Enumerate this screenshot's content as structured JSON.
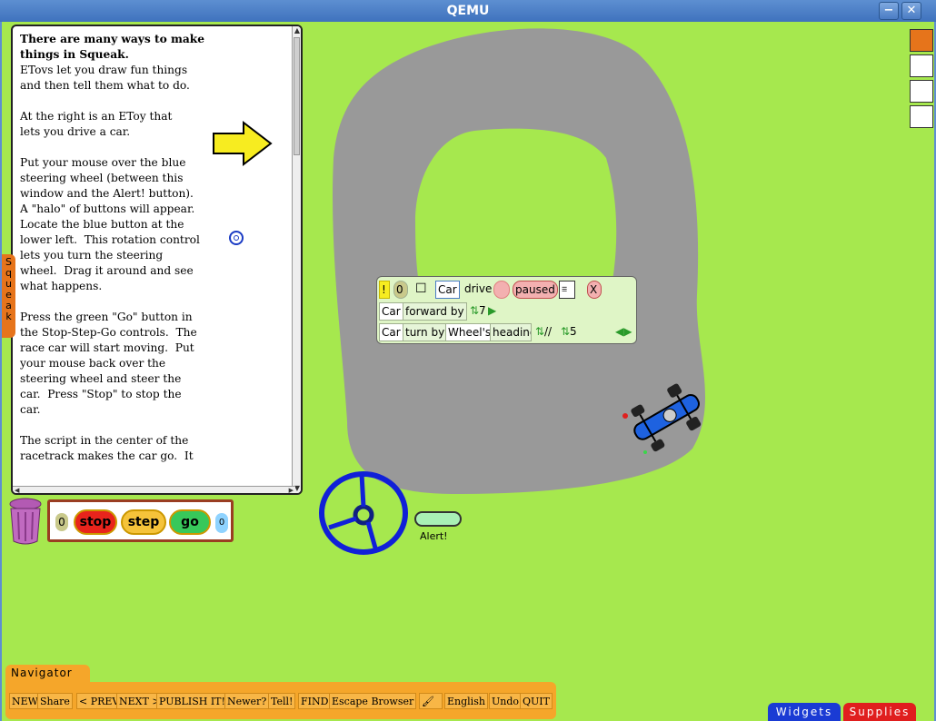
{
  "window": {
    "title": "QEMU",
    "minimize_icon": "−",
    "close_icon": "✕"
  },
  "text_window": {
    "heading": "There are many ways to make\nthings in Squeak.",
    "body": "\nETovs let you draw fun things\nand then tell them what to do.\n\nAt the right is an EToy that\nlets you drive a car.\n\nPut your mouse over the blue\nsteering wheel (between this\nwindow and the Alert! button).\nA \"halo\" of buttons will appear.\nLocate the blue button at the\nlower left.  This rotation control\nlets you turn the steering\nwheel.  Drag it around and see\nwhat happens.\n\nPress the green \"Go\" button in\nthe Stop-Step-Go controls.  The\nrace car will start moving.  Put\nyour mouse back over the\nsteering wheel and steer the\ncar.  Press \"Stop\" to stop the\ncar.\n\nThe script in the center of the\nracetrack makes the car go.  It"
  },
  "squeak_tab": {
    "label": "Squeak"
  },
  "stop_step_go": {
    "counter": "0",
    "stop": "stop",
    "step": "step",
    "go": "go",
    "speed": "0"
  },
  "script": {
    "row1": {
      "bang": "!",
      "zero": "0",
      "object": "Car",
      "name": "drive",
      "status": "paused",
      "close": "X"
    },
    "row2": {
      "object": "Car",
      "command": "forward by",
      "value": "7"
    },
    "row3": {
      "object": "Car",
      "command": "turn by",
      "source": "Wheel's",
      "property": "heading",
      "op": "//",
      "value": "5"
    }
  },
  "alert": {
    "label": "Alert!"
  },
  "navigator": {
    "tab_label": "Navigator",
    "items": [
      "NEW",
      "Share",
      "< PREV",
      "NEXT >",
      "PUBLISH IT!",
      "Newer?",
      "Tell!",
      "FIND",
      "Escape Browser",
      "English",
      "Undo",
      "QUIT"
    ]
  },
  "flaps": {
    "widgets": "Widgets",
    "supplies": "Supplies"
  },
  "colors": {
    "world": "#a6e84e",
    "track": "#999999",
    "wheel": "#1020d8",
    "car": "#1e62e0"
  }
}
